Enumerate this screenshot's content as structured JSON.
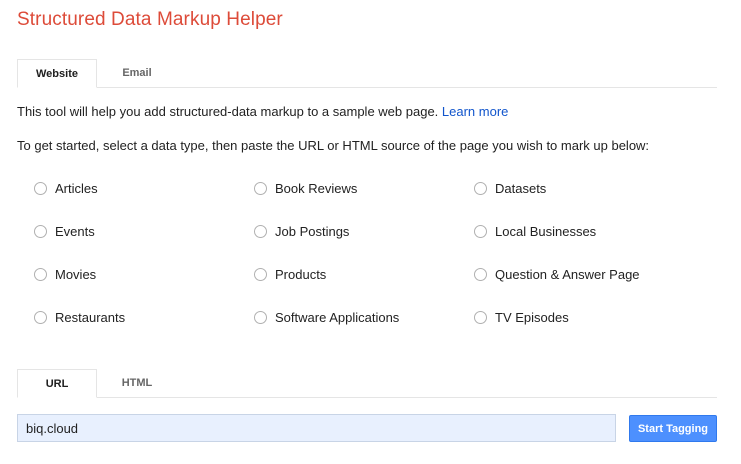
{
  "title": "Structured Data Markup Helper",
  "source_tabs": [
    {
      "label": "Website",
      "active": true
    },
    {
      "label": "Email",
      "active": false
    }
  ],
  "intro": {
    "text": "This tool will help you add structured-data markup to a sample web page.",
    "link": "Learn more"
  },
  "instructions": "To get started, select a data type, then paste the URL or HTML source of the page you wish to mark up below:",
  "data_types": [
    {
      "label": "Articles",
      "selected": false
    },
    {
      "label": "Book Reviews",
      "selected": false
    },
    {
      "label": "Datasets",
      "selected": false
    },
    {
      "label": "Events",
      "selected": false
    },
    {
      "label": "Job Postings",
      "selected": false
    },
    {
      "label": "Local Businesses",
      "selected": false
    },
    {
      "label": "Movies",
      "selected": false
    },
    {
      "label": "Products",
      "selected": false
    },
    {
      "label": "Question & Answer Page",
      "selected": false
    },
    {
      "label": "Restaurants",
      "selected": false
    },
    {
      "label": "Software Applications",
      "selected": false
    },
    {
      "label": "TV Episodes",
      "selected": false
    }
  ],
  "input_tabs": [
    {
      "label": "URL",
      "active": true
    },
    {
      "label": "HTML",
      "active": false
    }
  ],
  "url_input": {
    "value": "biq.cloud",
    "placeholder": ""
  },
  "start_button": "Start Tagging",
  "colors": {
    "title": "#dd4b39",
    "link": "#1155cc",
    "button": "#4d90fe",
    "input_bg": "#e8f0fe"
  }
}
